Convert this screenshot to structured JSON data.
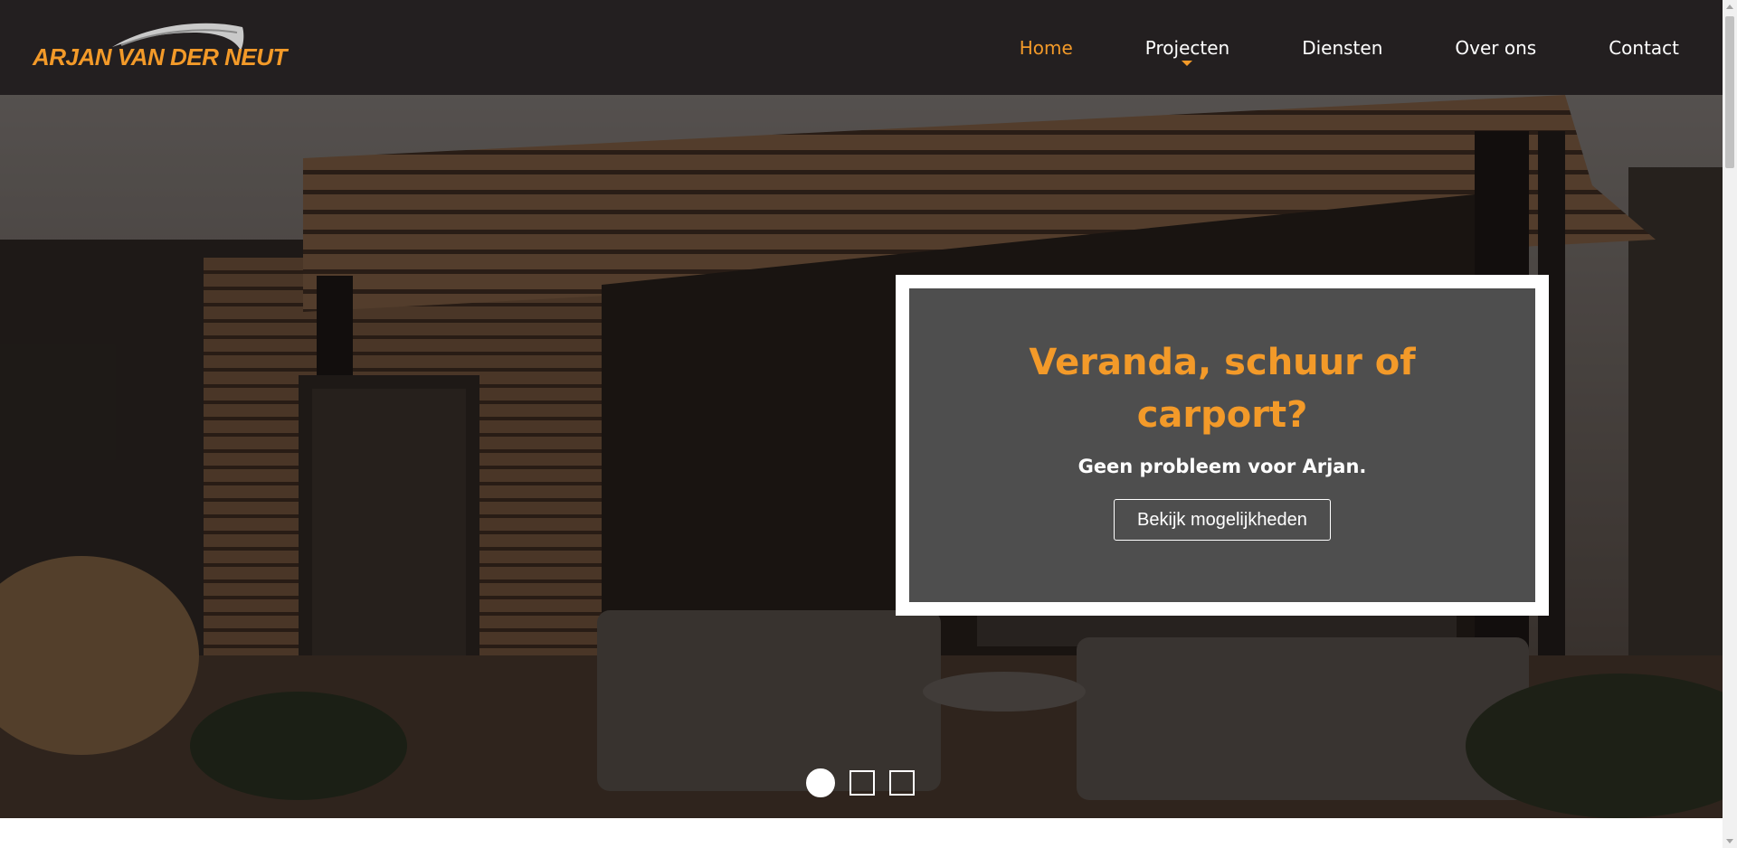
{
  "brand": {
    "name": "ARJAN VAN DER NEUT",
    "accent": "#f39a29",
    "header_bg": "#231f20"
  },
  "nav": {
    "items": [
      {
        "label": "Home",
        "active": true
      },
      {
        "label": "Projecten",
        "has_dropdown": true
      },
      {
        "label": "Diensten"
      },
      {
        "label": "Over ons"
      },
      {
        "label": "Contact"
      }
    ]
  },
  "hero": {
    "background": "photo-garden-shed-veranda",
    "title": "Veranda, schuur of carport?",
    "subtitle": "Geen probleem voor Arjan.",
    "cta_label": "Bekijk mogelijkheden",
    "slides": {
      "count": 3,
      "active_index": 0
    }
  },
  "icons": {
    "logo_swoosh": "swoosh-icon",
    "dropdown": "caret-down-icon",
    "scroll_up": "arrow-up-icon",
    "scroll_down": "arrow-down-icon"
  }
}
